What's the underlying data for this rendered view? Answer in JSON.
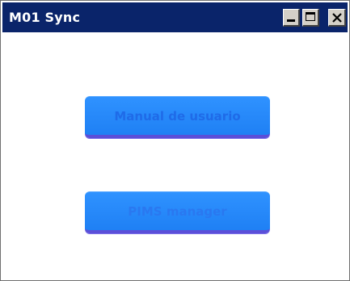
{
  "window": {
    "title": "M01 Sync"
  },
  "title_buttons": {
    "minimize_icon": "minimize-icon",
    "maximize_icon": "maximize-icon",
    "close_icon": "close-icon"
  },
  "buttons": {
    "manual_label": "Manual de usuario",
    "pims_label": "PIMS manager"
  },
  "colors": {
    "titlebar": "#0a246a",
    "button_fill": "#2584f8",
    "button_text": "#1f6be8",
    "button_underline": "#5b4fd8"
  }
}
